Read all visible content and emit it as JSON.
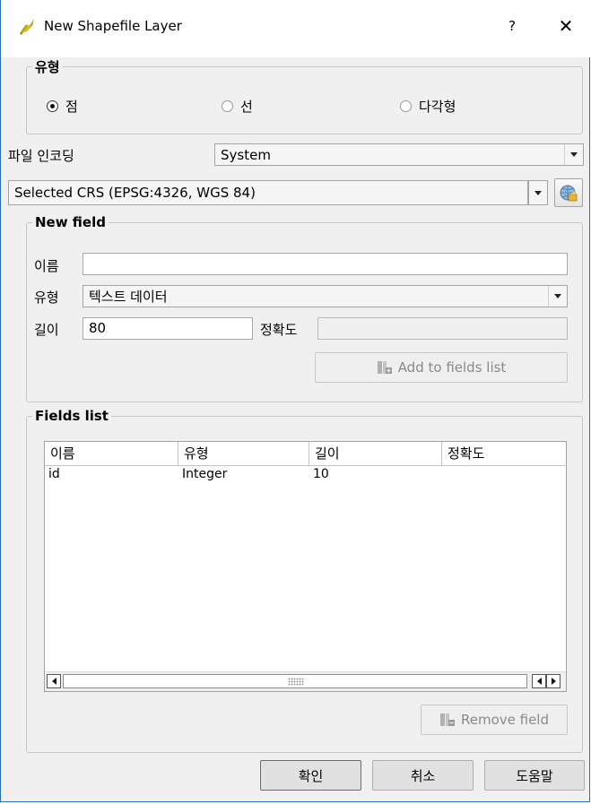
{
  "window": {
    "title": "New Shapefile Layer",
    "help": "?",
    "close": "✕"
  },
  "type_group": {
    "legend": "유형",
    "options": [
      {
        "label": "점",
        "checked": true
      },
      {
        "label": "선",
        "checked": false
      },
      {
        "label": "다각형",
        "checked": false
      }
    ]
  },
  "encoding": {
    "label": "파일 인코딩",
    "value": "System"
  },
  "crs": {
    "value": "Selected CRS (EPSG:4326, WGS 84)",
    "icon": "globe-crs-icon"
  },
  "new_field": {
    "legend": "New field",
    "name_label": "이름",
    "name_value": "",
    "type_label": "유형",
    "type_value": "텍스트 데이터",
    "length_label": "길이",
    "length_value": "80",
    "precision_label": "정확도",
    "precision_value": "",
    "add_button": "Add to fields list"
  },
  "fields_list": {
    "legend": "Fields list",
    "columns": [
      "이름",
      "유형",
      "길이",
      "정확도"
    ],
    "rows": [
      [
        "id",
        "Integer",
        "10",
        ""
      ]
    ],
    "remove_button": "Remove field"
  },
  "buttons": {
    "ok": "확인",
    "cancel": "취소",
    "help": "도움말"
  },
  "colors": {
    "accent": "#2b6fb3",
    "window_bg": "#f0f0f0"
  }
}
